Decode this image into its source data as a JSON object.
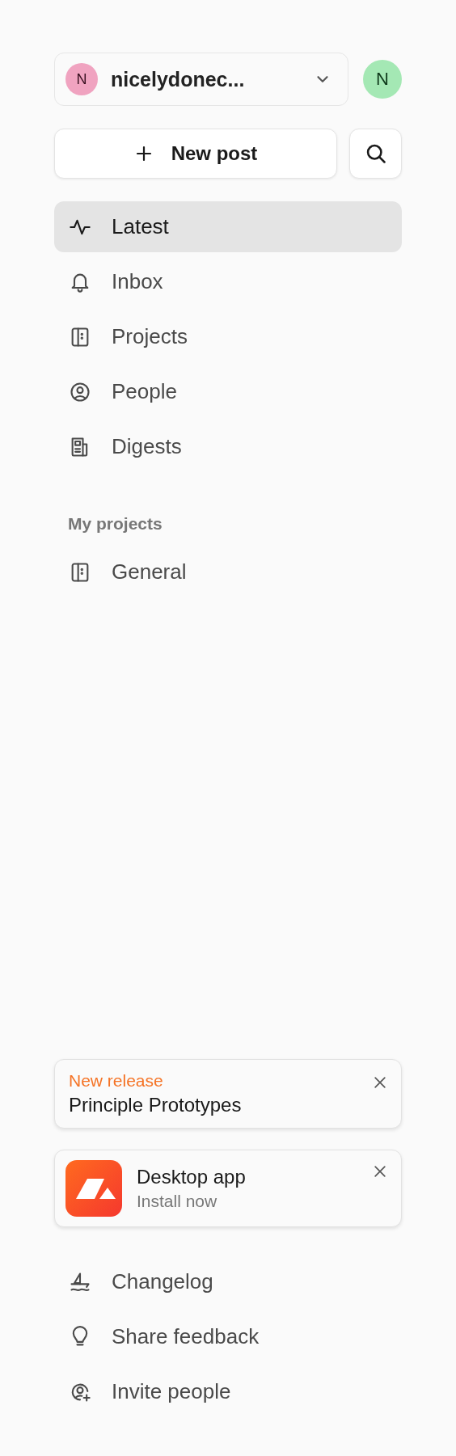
{
  "workspace": {
    "avatar": "N",
    "name": "nicelydonec..."
  },
  "user_avatar": "N",
  "new_post_button": "New post",
  "nav": [
    {
      "label": "Latest",
      "selected": true
    },
    {
      "label": "Inbox",
      "selected": false
    },
    {
      "label": "Projects",
      "selected": false
    },
    {
      "label": "People",
      "selected": false
    },
    {
      "label": "Digests",
      "selected": false
    }
  ],
  "my_projects": {
    "heading": "My projects",
    "items": [
      {
        "label": "General",
        "selected": false
      }
    ]
  },
  "release_card": {
    "eyebrow": "New release",
    "title": "Principle Prototypes"
  },
  "desktop_card": {
    "title": "Desktop app",
    "subtitle": "Install now"
  },
  "footer_links": [
    {
      "label": "Changelog"
    },
    {
      "label": "Share feedback"
    },
    {
      "label": "Invite people"
    }
  ]
}
